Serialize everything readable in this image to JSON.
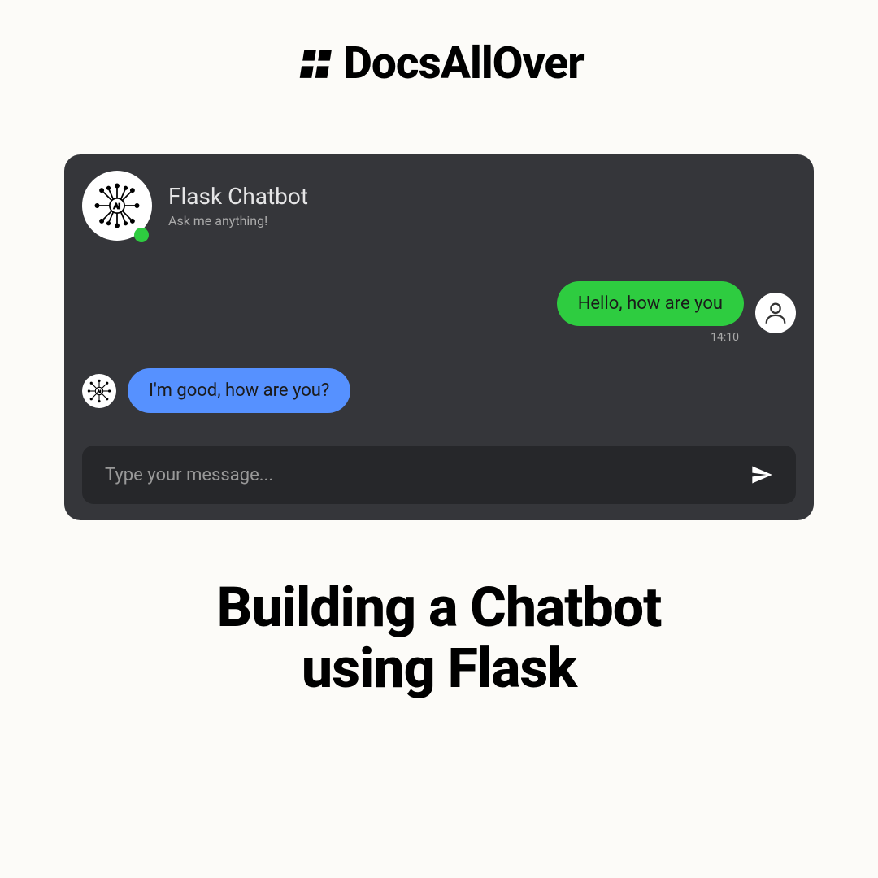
{
  "brand": {
    "name": "DocsAllOver"
  },
  "chat": {
    "header": {
      "title": "Flask Chatbot",
      "subtitle": "Ask me anything!"
    },
    "messages": [
      {
        "sender": "user",
        "text": "Hello, how are you",
        "timestamp": "14:10"
      },
      {
        "sender": "bot",
        "text": "I'm good, how are you?"
      }
    ],
    "input": {
      "placeholder": "Type your message..."
    }
  },
  "page": {
    "title_line1": "Building a Chatbot",
    "title_line2": "using Flask"
  }
}
